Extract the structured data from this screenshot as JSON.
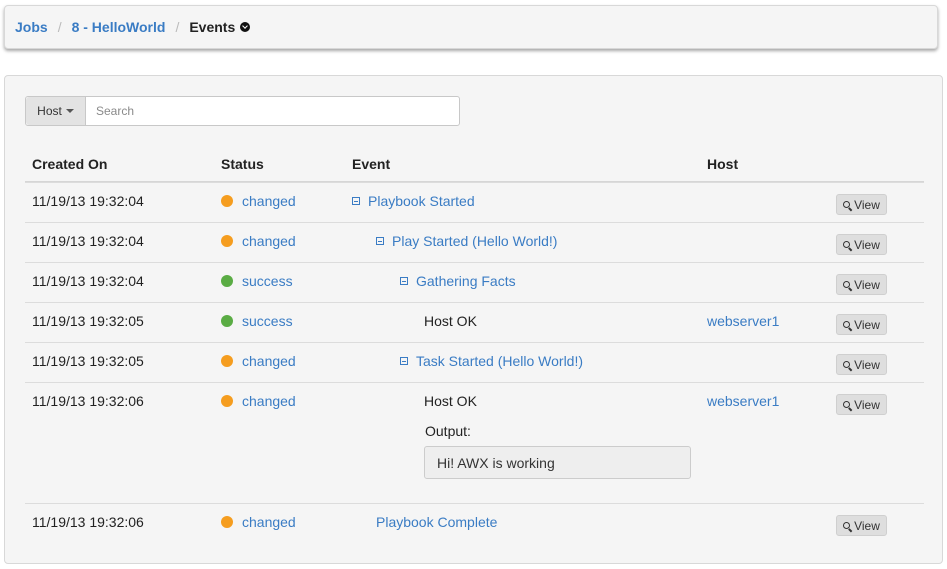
{
  "breadcrumb": {
    "items": [
      "Jobs",
      "8 - HelloWorld"
    ],
    "separator": "/",
    "current": "Events"
  },
  "search": {
    "filter_label": "Host",
    "placeholder": "Search",
    "value": ""
  },
  "table": {
    "columns": [
      "Created On",
      "Status",
      "Event",
      "Host"
    ],
    "view_label": "View",
    "output_label": "Output:",
    "rows": [
      {
        "created": "11/19/13 19:32:04",
        "status": "changed",
        "event": "Playbook Started",
        "host": ""
      },
      {
        "created": "11/19/13 19:32:04",
        "status": "changed",
        "event": "Play Started (Hello World!)",
        "host": ""
      },
      {
        "created": "11/19/13 19:32:04",
        "status": "success",
        "event": "Gathering Facts",
        "host": ""
      },
      {
        "created": "11/19/13 19:32:05",
        "status": "success",
        "event": "Host OK",
        "host": "webserver1"
      },
      {
        "created": "11/19/13 19:32:05",
        "status": "changed",
        "event": "Task Started (Hello World!)",
        "host": ""
      },
      {
        "created": "11/19/13 19:32:06",
        "status": "changed",
        "event": "Host OK",
        "host": "webserver1",
        "output": "Hi! AWX is working"
      },
      {
        "created": "11/19/13 19:32:06",
        "status": "changed",
        "event": "Playbook Complete",
        "host": ""
      }
    ]
  },
  "colors": {
    "changed": "#f59d1f",
    "success": "#5aac44",
    "link": "#3a7cc4"
  }
}
